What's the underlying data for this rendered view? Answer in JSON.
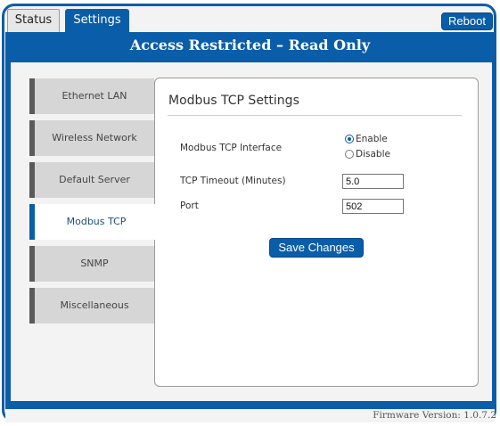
{
  "tabs": {
    "status": "Status",
    "settings": "Settings"
  },
  "header": {
    "reboot_label": "Reboot",
    "banner": "Access Restricted – Read Only"
  },
  "sidebar": {
    "items": [
      {
        "label": "Ethernet LAN",
        "active": false
      },
      {
        "label": "Wireless Network",
        "active": false
      },
      {
        "label": "Default Server",
        "active": false
      },
      {
        "label": "Modbus TCP",
        "active": true
      },
      {
        "label": "SNMP",
        "active": false
      },
      {
        "label": "Miscellaneous",
        "active": false
      }
    ]
  },
  "panel": {
    "title": "Modbus TCP Settings",
    "interface_label": "Modbus TCP Interface",
    "enable_label": "Enable",
    "disable_label": "Disable",
    "selected": "Enable",
    "timeout_label": "TCP Timeout (Minutes)",
    "timeout_value": "5.0",
    "port_label": "Port",
    "port_value": "502",
    "save_label": "Save Changes"
  },
  "footer": {
    "firmware": "Firmware Version: 1.0.7.2"
  },
  "colors": {
    "accent": "#0a5da8",
    "background": "#f3f3f3",
    "nav_inactive": "#d6d6d6"
  },
  "icons": {
    "radio_selected": "radio-checked-icon",
    "radio_unselected": "radio-unchecked-icon"
  }
}
